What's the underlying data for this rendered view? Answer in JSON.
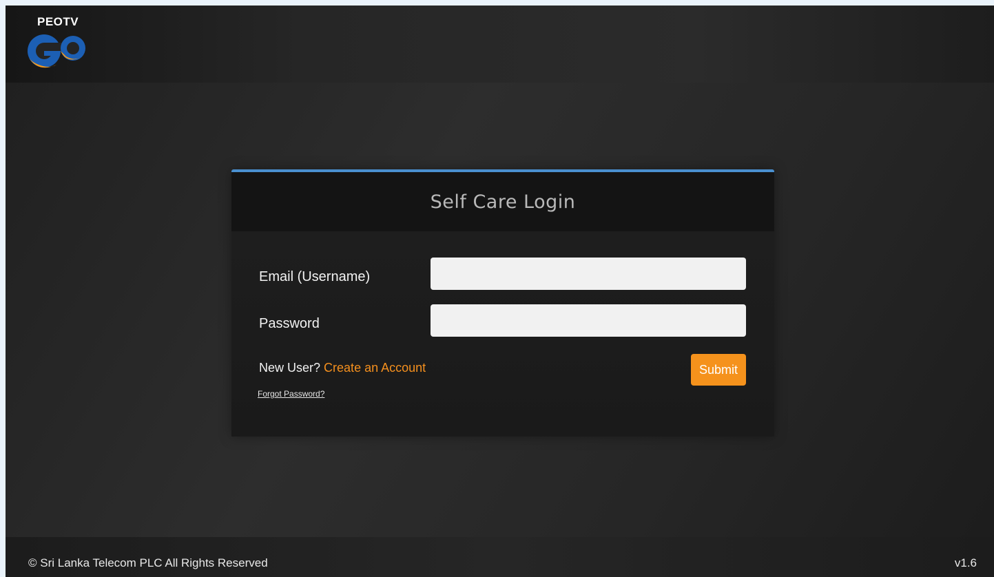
{
  "brand": {
    "logo_text": "PEOTV",
    "logo_colors": {
      "primary": "#1c5fb4",
      "secondary": "#f49a1d"
    }
  },
  "login": {
    "title": "Self Care Login",
    "email_label": "Email (Username)",
    "email_value": "",
    "password_label": "Password",
    "password_value": "",
    "new_user_text": "New User?",
    "create_account_link": "Create an Account",
    "forgot_password_link": "Forgot Password?",
    "submit_label": "Submit",
    "accent_color": "#4a90d0",
    "button_color": "#f5921c"
  },
  "footer": {
    "copyright": "© Sri Lanka Telecom PLC All Rights Reserved",
    "version": "v1.6"
  }
}
